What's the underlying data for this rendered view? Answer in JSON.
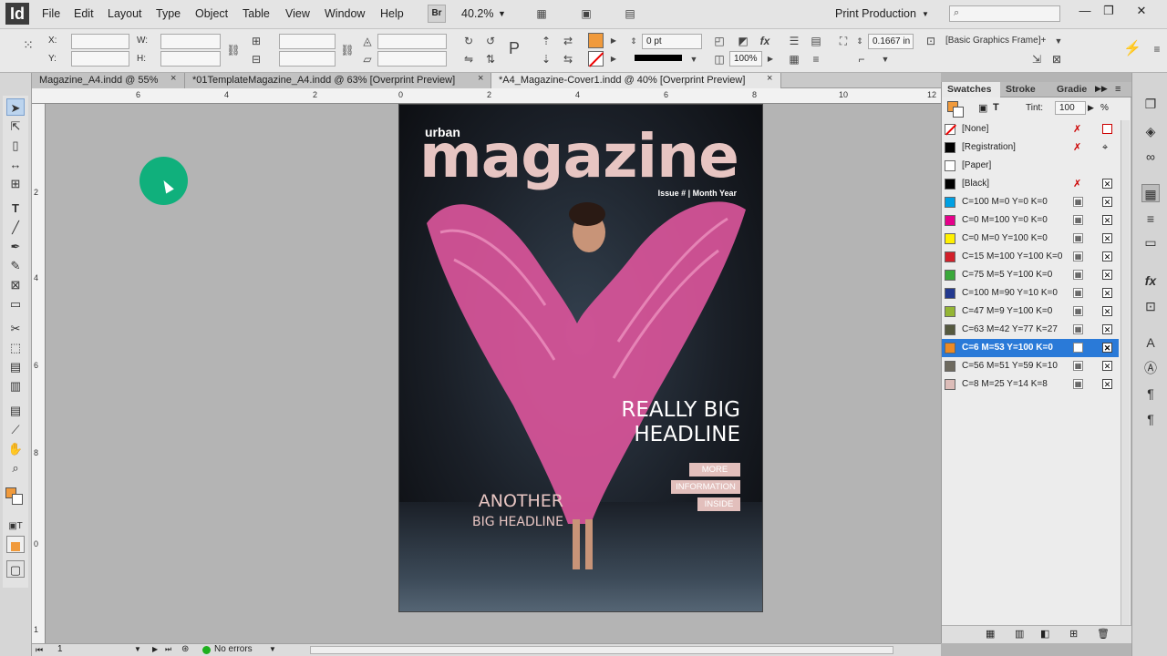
{
  "app": {
    "logo": "Id"
  },
  "menu": [
    "File",
    "Edit",
    "Layout",
    "Type",
    "Object",
    "Table",
    "View",
    "Window",
    "Help"
  ],
  "appbar": {
    "bridge": "Br",
    "zoom": "40.2%",
    "workspace": "Print Production",
    "search_placeholder": ""
  },
  "window_controls": {
    "minimize": "—",
    "restore": "❐",
    "close": "✕"
  },
  "control": {
    "x_label": "X:",
    "y_label": "Y:",
    "w_label": "W:",
    "h_label": "H:",
    "stroke_weight": "0 pt",
    "scale": "100%",
    "offset": "0.1667 in",
    "object_style": "[Basic Graphics Frame]+",
    "fill_color": "#f09a3c"
  },
  "tabs": [
    {
      "label": "Magazine_A4.indd @ 55%",
      "close": "×"
    },
    {
      "label": "*01TemplateMagazine_A4.indd @ 63% [Overprint Preview]",
      "close": "×"
    },
    {
      "label": "*A4_Magazine-Cover1.indd @ 40% [Overprint Preview]",
      "close": "×"
    }
  ],
  "ruler": {
    "h_ticks": [
      "6",
      "4",
      "2",
      "0",
      "2",
      "4",
      "6",
      "8",
      "10",
      "12"
    ],
    "v_ticks": [
      "2",
      "4",
      "6",
      "8",
      "0",
      "1"
    ]
  },
  "cover": {
    "brand": "urban",
    "title": "magazine",
    "issue": "Issue # | Month Year",
    "headline1_line1": "REALLY BIG",
    "headline1_line2": "HEADLINE",
    "tags": [
      "MORE",
      "INFORMATION",
      "INSIDE"
    ],
    "headline2_line1": "ANOTHER",
    "headline2_line2": "BIG HEADLINE"
  },
  "status": {
    "page": "1",
    "preflight": "No errors"
  },
  "panel": {
    "tabs": [
      "Swatches",
      "Stroke",
      "Gradie"
    ],
    "tint_label": "Tint:",
    "tint_value": "100",
    "tint_unit": "%",
    "swatches": [
      {
        "name": "[None]",
        "color": "#ffffff"
      },
      {
        "name": "[Registration]",
        "color": "#000000"
      },
      {
        "name": "[Paper]",
        "color": "#ffffff"
      },
      {
        "name": "[Black]",
        "color": "#000000"
      },
      {
        "name": "C=100 M=0 Y=0 K=0",
        "color": "#00a0e3"
      },
      {
        "name": "C=0 M=100 Y=0 K=0",
        "color": "#e5008a"
      },
      {
        "name": "C=0 M=0 Y=100 K=0",
        "color": "#fff000"
      },
      {
        "name": "C=15 M=100 Y=100 K=0",
        "color": "#d2202a"
      },
      {
        "name": "C=75 M=5 Y=100 K=0",
        "color": "#3aa83a"
      },
      {
        "name": "C=100 M=90 Y=10 K=0",
        "color": "#23398f"
      },
      {
        "name": "C=47 M=9 Y=100 K=0",
        "color": "#94b534"
      },
      {
        "name": "C=63 M=42 Y=77 K=27",
        "color": "#55593f"
      },
      {
        "name": "C=6 M=53 Y=100 K=0",
        "color": "#ec8a24",
        "selected": true
      },
      {
        "name": "C=56 M=51 Y=59 K=10",
        "color": "#6e6a5f"
      },
      {
        "name": "C=8 M=25 Y=14 K=8",
        "color": "#dcbcb8"
      }
    ]
  }
}
